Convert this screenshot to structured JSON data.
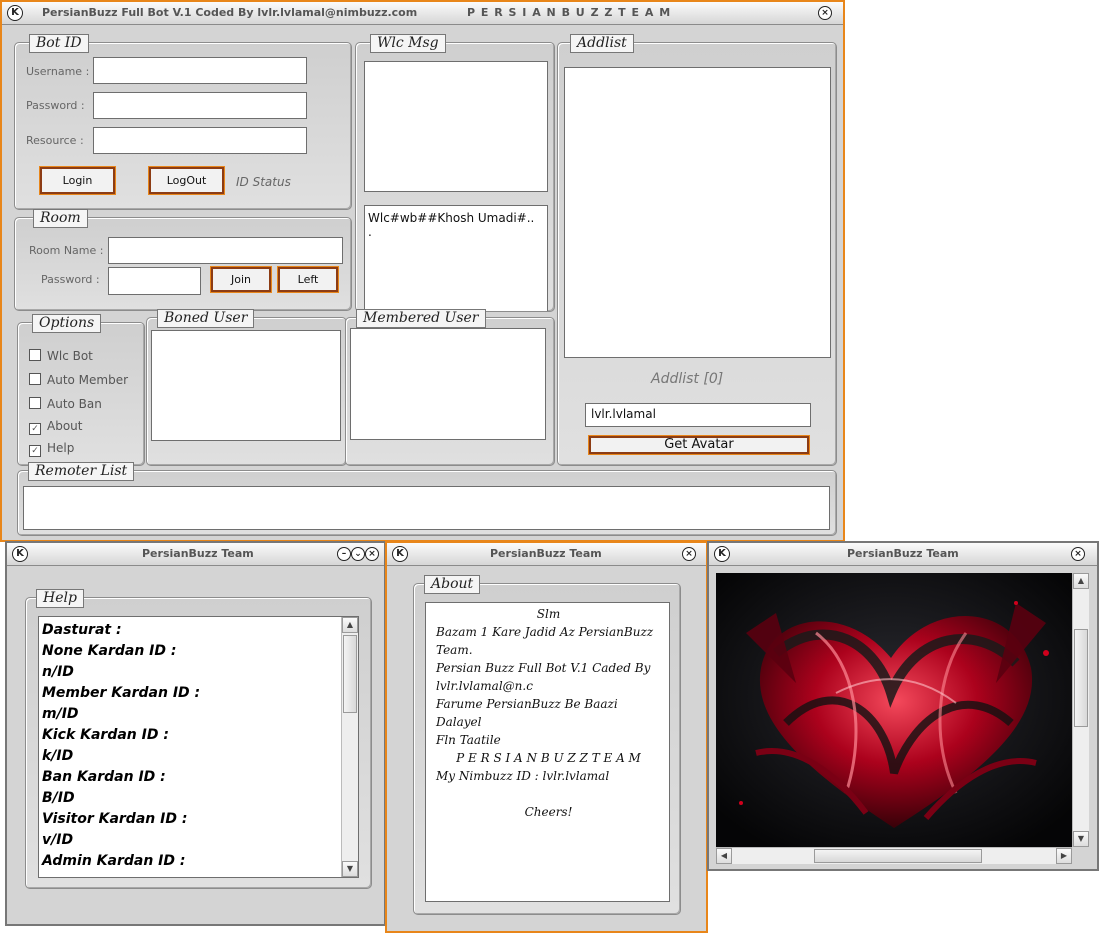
{
  "main": {
    "title": "PersianBuzz Full Bot V.1 Coded By lvlr.lvlamal@nimbuzz.com",
    "title_right": "P  E  R  S  I  A  N  B  U  Z  Z        T  E  A  M",
    "bot_id": {
      "title": "Bot ID",
      "username_label": "Username :",
      "password_label": "Password :",
      "resource_label": "Resource :",
      "login_label": "Login",
      "logout_label": "LogOut",
      "status": "ID Status"
    },
    "room": {
      "title": "Room",
      "room_name_label": "Room Name :",
      "password_label": "Password :",
      "join_label": "Join",
      "left_label": "Left"
    },
    "wlc_msg": {
      "title": "Wlc Msg",
      "template": "Wlc#wb##Khosh Umadi#..",
      "template_cont": "."
    },
    "addlist": {
      "title": "Addlist",
      "count": "Addlist [0]",
      "user_value": "lvlr.lvlamal",
      "get_avatar_label": "Get Avatar"
    },
    "options": {
      "title": "Options",
      "items": [
        {
          "label": "Wlc Bot",
          "checked": false
        },
        {
          "label": "Auto Member",
          "checked": false
        },
        {
          "label": "Auto Ban",
          "checked": false
        },
        {
          "label": "About",
          "checked": true
        },
        {
          "label": "Help",
          "checked": true
        }
      ]
    },
    "boned_user": {
      "title": "Boned User"
    },
    "membered_user": {
      "title": "Membered User"
    },
    "remoter_list": {
      "title": "Remoter List"
    }
  },
  "help_window": {
    "title": "PersianBuzz Team",
    "group_title": "Help",
    "lines": [
      "Dasturat :",
      "None Kardan ID :",
      "n/ID",
      "Member Kardan ID :",
      "m/ID",
      "Kick Kardan ID :",
      "k/ID",
      "Ban Kardan ID :",
      "B/ID",
      "Visitor Kardan ID :",
      "v/ID",
      "Admin Kardan ID :"
    ]
  },
  "about_window": {
    "title": "PersianBuzz Team",
    "group_title": "About",
    "lines": [
      "Slm",
      "Bazam 1 Kare Jadid Az PersianBuzz",
      "Team.",
      "Persian Buzz Full Bot V.1 Caded By",
      "lvlr.lvlamal@n.c",
      "Farume PersianBuzz Be Baazi",
      "Dalayel",
      "Fln Taatile",
      "P E R S I A N B U Z Z   T E A M",
      "My Nimbuzz ID : lvlr.lvlamal",
      "",
      "Cheers!"
    ]
  },
  "image_window": {
    "title": "PersianBuzz Team",
    "image_subject": "red-crystal-heart"
  },
  "icons": {
    "logo": "K",
    "close": "×",
    "minimize": "–",
    "restore": "⌄",
    "up": "▲",
    "down": "▼",
    "left": "◀",
    "right": "▶",
    "check": "✓"
  },
  "colors": {
    "frame_accent": "#e8861a",
    "button_border": "#8c3c14",
    "panel_bg": "#d4d4d4"
  }
}
